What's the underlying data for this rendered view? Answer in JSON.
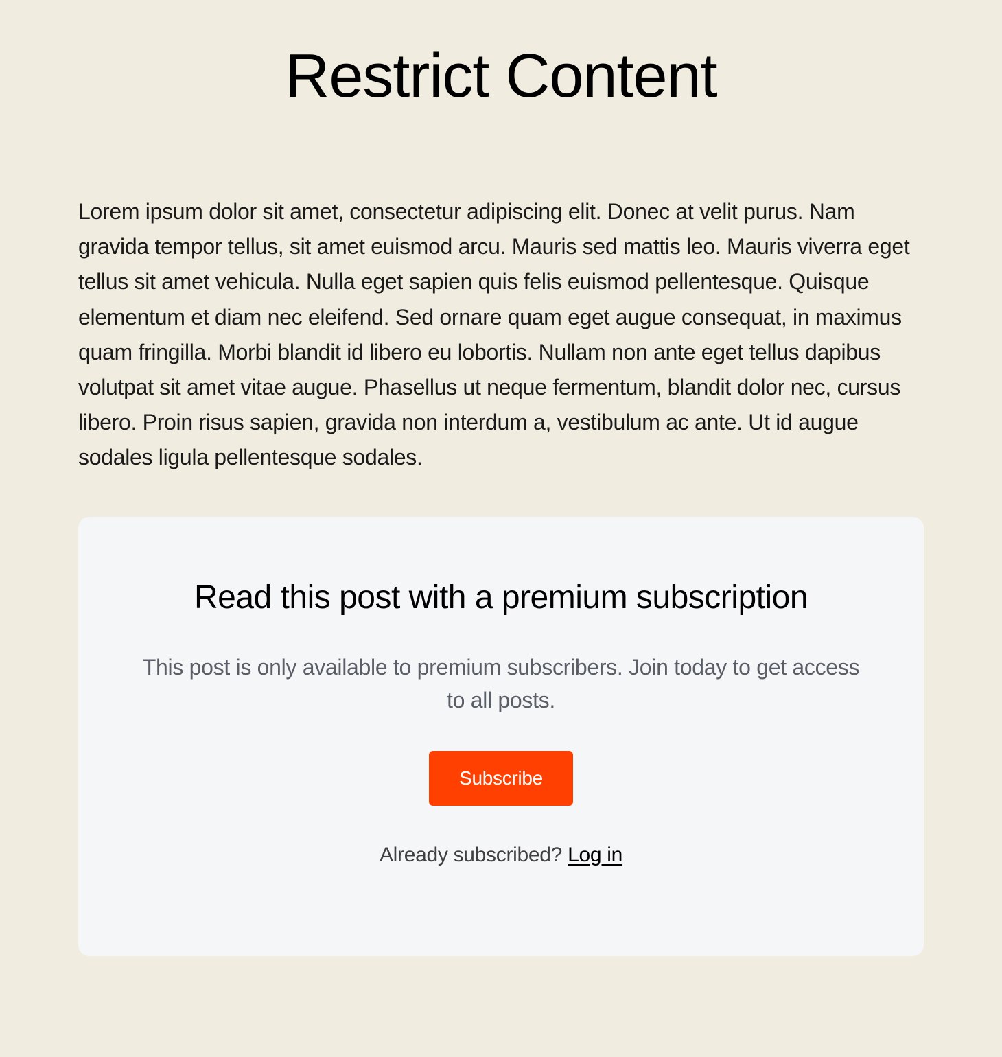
{
  "page": {
    "title": "Restrict Content",
    "body_text": "Lorem ipsum dolor sit amet, consectetur adipiscing elit. Donec at velit purus. Nam gravida tempor tellus, sit amet euismod arcu. Mauris sed mattis leo. Mauris viverra eget tellus sit amet vehicula. Nulla eget sapien quis felis euismod pellentesque. Quisque elementum et diam nec eleifend. Sed ornare quam eget augue consequat, in maximus quam fringilla. Morbi blandit id libero eu lobortis. Nullam non ante eget tellus dapibus volutpat sit amet vitae augue. Phasellus ut neque fermentum, blandit dolor nec, cursus libero. Proin risus sapien, gravida non interdum a, vestibulum ac ante. Ut id augue sodales ligula pellentesque sodales."
  },
  "paywall": {
    "heading": "Read this post with a premium subscription",
    "description": "This post is only available to premium subscribers. Join today to get access to all posts.",
    "subscribe_label": "Subscribe",
    "login_prompt_prefix": "Already subscribed? ",
    "login_link_label": "Log in"
  },
  "colors": {
    "background": "#f0ecdf",
    "card_background": "#f5f6f8",
    "accent": "#ff4000",
    "text_primary": "#1a1a1a",
    "text_secondary": "#5a5e66"
  }
}
